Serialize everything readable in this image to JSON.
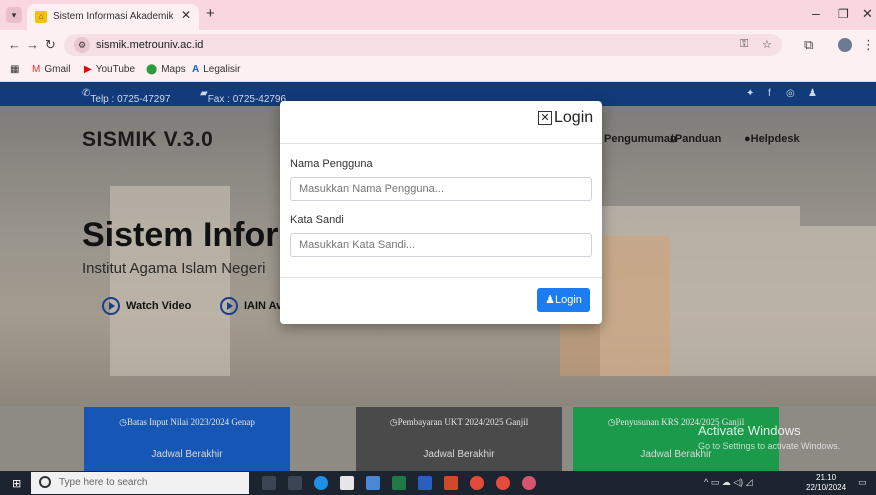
{
  "browser": {
    "tab_title": "Sistem Informasi Akademik [SIS",
    "url": "sismik.metrouniv.ac.id",
    "bookmarks": [
      "Gmail",
      "YouTube",
      "Maps",
      "Legalisir"
    ]
  },
  "site": {
    "phone": "Telp : 0725-47297",
    "fax": "Fax : 0725-42796",
    "brand": "SISMIK V.3.0",
    "nav": [
      "Pengumuman",
      "Panduan",
      "Helpdesk"
    ],
    "hero_title": "Sistem Informasi",
    "hero_subtitle": "Institut Agama Islam Negeri",
    "hero_buttons": [
      "Watch Video",
      "IAIN Av"
    ],
    "cards": [
      {
        "title": "Batas Input Nilai 2023/2024 Genap",
        "subtitle": "Jadwal Berakhir",
        "color": "#1657b5"
      },
      {
        "title": "Pembayaran UKT 2024/2025 Ganjil",
        "subtitle": "Jadwal Berakhir",
        "color": "#4a4a4a"
      },
      {
        "title": "Penyusunan KRS 2024/2025 Ganjil",
        "subtitle": "Jadwal Berakhir",
        "color": "#1a9a4a"
      }
    ]
  },
  "modal": {
    "title": "Login",
    "username_label": "Nama Pengguna",
    "username_placeholder": "Masukkan Nama Pengguna...",
    "password_label": "Kata Sandi",
    "password_placeholder": "Masukkan Kata Sandi...",
    "submit_label": "Login"
  },
  "watermark": {
    "line1": "Activate Windows",
    "line2": "Go to Settings to activate Windows."
  },
  "taskbar": {
    "search_placeholder": "Type here to search",
    "time": "21.10",
    "date": "22/10/2024"
  }
}
